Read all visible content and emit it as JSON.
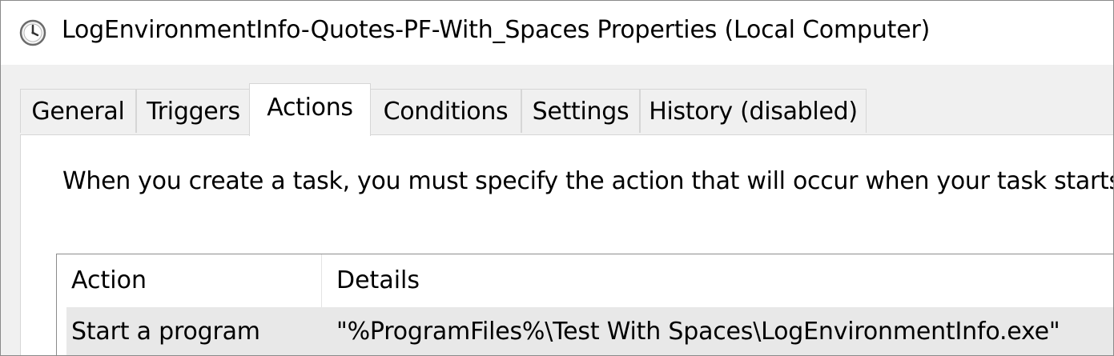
{
  "window": {
    "title": "LogEnvironmentInfo-Quotes-PF-With_Spaces Properties (Local Computer)",
    "icon": "clock-icon"
  },
  "tabs": [
    {
      "label": "General",
      "selected": false
    },
    {
      "label": "Triggers",
      "selected": false
    },
    {
      "label": "Actions",
      "selected": true
    },
    {
      "label": "Conditions",
      "selected": false
    },
    {
      "label": "Settings",
      "selected": false
    },
    {
      "label": "History (disabled)",
      "selected": false
    }
  ],
  "actions_panel": {
    "instruction": "When you create a task, you must specify the action that will occur when your task starts.",
    "columns": [
      "Action",
      "Details"
    ],
    "rows": [
      {
        "action": "Start a program",
        "details": "\"%ProgramFiles%\\Test With Spaces\\LogEnvironmentInfo.exe\"",
        "selected": true
      }
    ]
  },
  "colors": {
    "dialog_background": "#f0f0f0",
    "tab_border": "#d6d6d6",
    "selected_row": "#e8e8e8",
    "list_border": "#8c8c8c"
  }
}
